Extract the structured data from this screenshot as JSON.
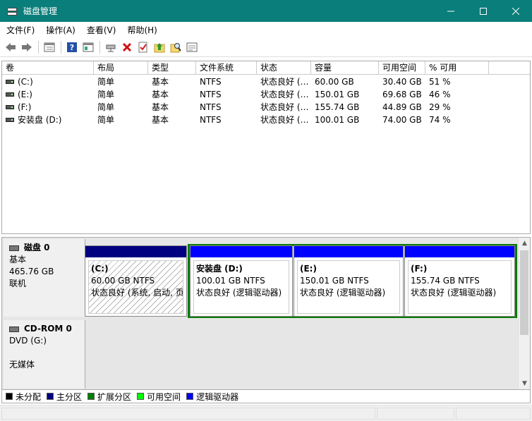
{
  "window": {
    "title": "磁盘管理"
  },
  "menu": [
    "文件(F)",
    "操作(A)",
    "查看(V)",
    "帮助(H)"
  ],
  "toolbar": {
    "icons": [
      "back-arrow-icon",
      "forward-arrow-icon",
      "view-icon",
      "help-icon",
      "properties-icon",
      "connect-icon",
      "delete-icon",
      "check-icon",
      "up-icon",
      "search-icon",
      "settings-icon"
    ]
  },
  "volume_list": {
    "columns": [
      "卷",
      "布局",
      "类型",
      "文件系统",
      "状态",
      "容量",
      "可用空间",
      "% 可用"
    ],
    "rows": [
      {
        "volume": "(C:)",
        "layout": "简单",
        "type": "基本",
        "fs": "NTFS",
        "status": "状态良好 (…",
        "capacity": "60.00 GB",
        "free": "30.40 GB",
        "pct": "51 %"
      },
      {
        "volume": "(E:)",
        "layout": "简单",
        "type": "基本",
        "fs": "NTFS",
        "status": "状态良好 (…",
        "capacity": "150.01 GB",
        "free": "69.68 GB",
        "pct": "46 %"
      },
      {
        "volume": "(F:)",
        "layout": "简单",
        "type": "基本",
        "fs": "NTFS",
        "status": "状态良好 (…",
        "capacity": "155.74 GB",
        "free": "44.89 GB",
        "pct": "29 %"
      },
      {
        "volume": "安装盘 (D:)",
        "layout": "简单",
        "type": "基本",
        "fs": "NTFS",
        "status": "状态良好 (…",
        "capacity": "100.01 GB",
        "free": "74.00 GB",
        "pct": "74 %"
      }
    ]
  },
  "disks": [
    {
      "name": "磁盘 0",
      "type": "基本",
      "size": "465.76 GB",
      "state": "联机",
      "partitions": [
        {
          "name": "(C:)",
          "size": "60.00 GB NTFS",
          "status": "状态良好 (系统, 启动, 页",
          "kind": "primary"
        },
        {
          "name": "安装盘  (D:)",
          "size": "100.01 GB NTFS",
          "status": "状态良好 (逻辑驱动器)",
          "kind": "logical"
        },
        {
          "name": "(E:)",
          "size": "150.01 GB NTFS",
          "status": "状态良好 (逻辑驱动器)",
          "kind": "logical"
        },
        {
          "name": "(F:)",
          "size": "155.74 GB NTFS",
          "status": "状态良好 (逻辑驱动器)",
          "kind": "logical"
        }
      ]
    },
    {
      "name": "CD-ROM 0",
      "type": "DVD (G:)",
      "state": "无媒体"
    }
  ],
  "legend": [
    {
      "label": "未分配",
      "color": "#000000"
    },
    {
      "label": "主分区",
      "color": "#000080"
    },
    {
      "label": "扩展分区",
      "color": "#008000"
    },
    {
      "label": "可用空间",
      "color": "#00ff00"
    },
    {
      "label": "逻辑驱动器",
      "color": "#0000ff"
    }
  ],
  "colors": {
    "titlebar": "#0a7e7a",
    "primary": "#000080",
    "logical": "#0000ff",
    "extended": "#0a7a0a"
  }
}
